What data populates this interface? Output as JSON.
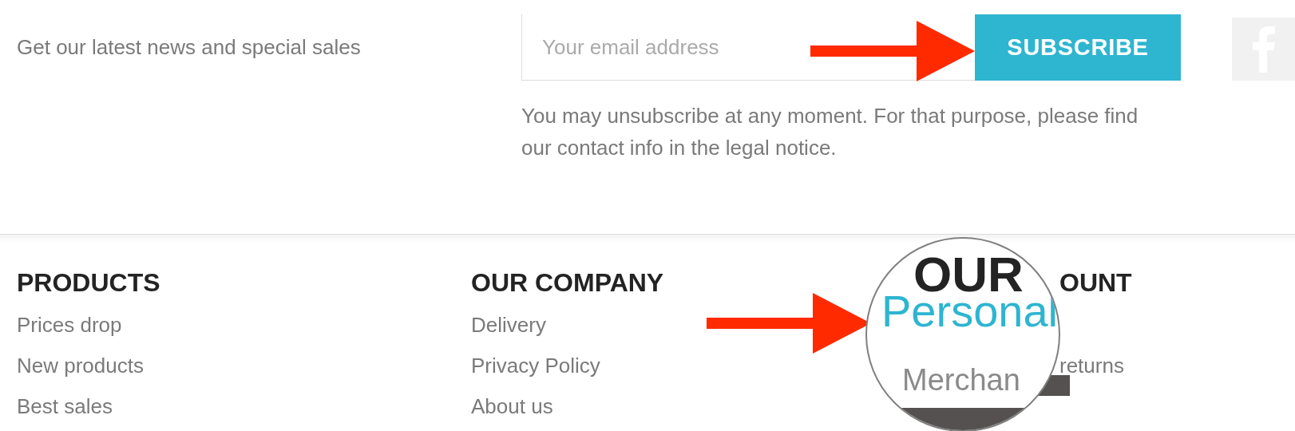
{
  "newsletter": {
    "label": "Get our latest news and special sales",
    "email_placeholder": "Your email address",
    "button": "SUBSCRIBE",
    "note": "You may unsubscribe at any moment. For that purpose, please find our contact info in the legal notice."
  },
  "social": [
    {
      "kind": "facebook"
    }
  ],
  "footer": {
    "columns": [
      {
        "title": "PRODUCTS",
        "links": [
          "Prices drop",
          "New products",
          "Best sales"
        ]
      },
      {
        "title": "OUR COMPANY",
        "links": [
          "Delivery",
          "Privacy Policy",
          "About us"
        ]
      },
      {
        "title": "OUNT",
        "links": [
          "returns"
        ]
      }
    ]
  },
  "magnifier": {
    "heading": "OUR",
    "highlight": "Personal",
    "next": "Merchan"
  }
}
